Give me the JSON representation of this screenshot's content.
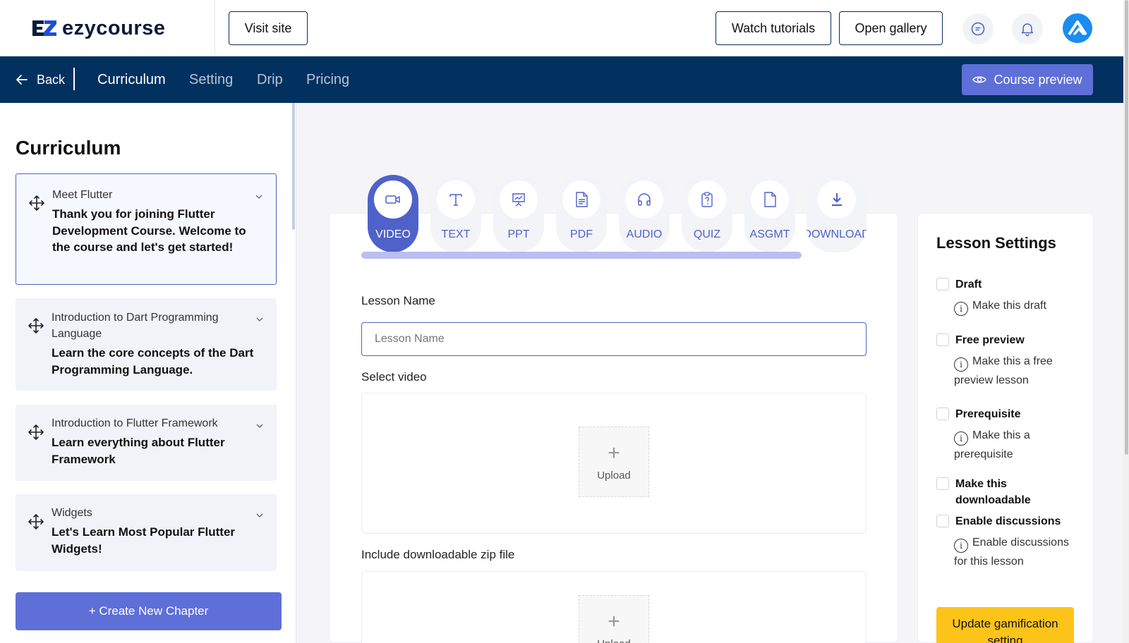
{
  "app": {
    "name": "ezycourse"
  },
  "header": {
    "visit_site": "Visit site",
    "watch_tutorials": "Watch tutorials",
    "open_gallery": "Open gallery"
  },
  "nav": {
    "back": "Back",
    "tabs": [
      {
        "label": "Curriculum",
        "active": true
      },
      {
        "label": "Setting",
        "active": false
      },
      {
        "label": "Drip",
        "active": false
      },
      {
        "label": "Pricing",
        "active": false
      }
    ],
    "course_preview": "Course preview"
  },
  "sidebar": {
    "title": "Curriculum",
    "chapters": [
      {
        "title": "Meet Flutter",
        "description": "Thank you for joining Flutter Development Course. Welcome to the course and let's get started!"
      },
      {
        "title": "Introduction to Dart Programming Language",
        "description": "Learn the core concepts of the Dart Programming Language."
      },
      {
        "title": "Introduction to Flutter Framework",
        "description": "Learn everything about Flutter Framework"
      },
      {
        "title": "Widgets",
        "description": "Let's Learn Most Popular Flutter Widgets!"
      }
    ],
    "create_chapter": "+ Create New Chapter"
  },
  "lesson_types": [
    "VIDEO",
    "TEXT",
    "PPT",
    "PDF",
    "AUDIO",
    "QUIZ",
    "ASGMT",
    "DOWNLOAD"
  ],
  "form": {
    "lesson_name_label": "Lesson Name",
    "lesson_name_placeholder": "Lesson Name",
    "select_video_label": "Select video",
    "zip_label": "Include downloadable zip file",
    "upload_label": "Upload"
  },
  "settings": {
    "title": "Lesson Settings",
    "draft": "Draft",
    "draft_hint": "Make this draft",
    "free_preview": "Free preview",
    "free_preview_hint": "Make this a free preview lesson",
    "prerequisite": "Prerequisite",
    "prerequisite_hint": "Make this a prerequisite",
    "downloadable": "Make this downloadable",
    "discussions": "Enable discussions",
    "discussions_hint": "Enable discussions for this lesson",
    "gamification": "Update gamification setting"
  },
  "colors": {
    "navbar": "#03315f",
    "accent": "#5e6fd8",
    "gamification": "#fcc419"
  }
}
